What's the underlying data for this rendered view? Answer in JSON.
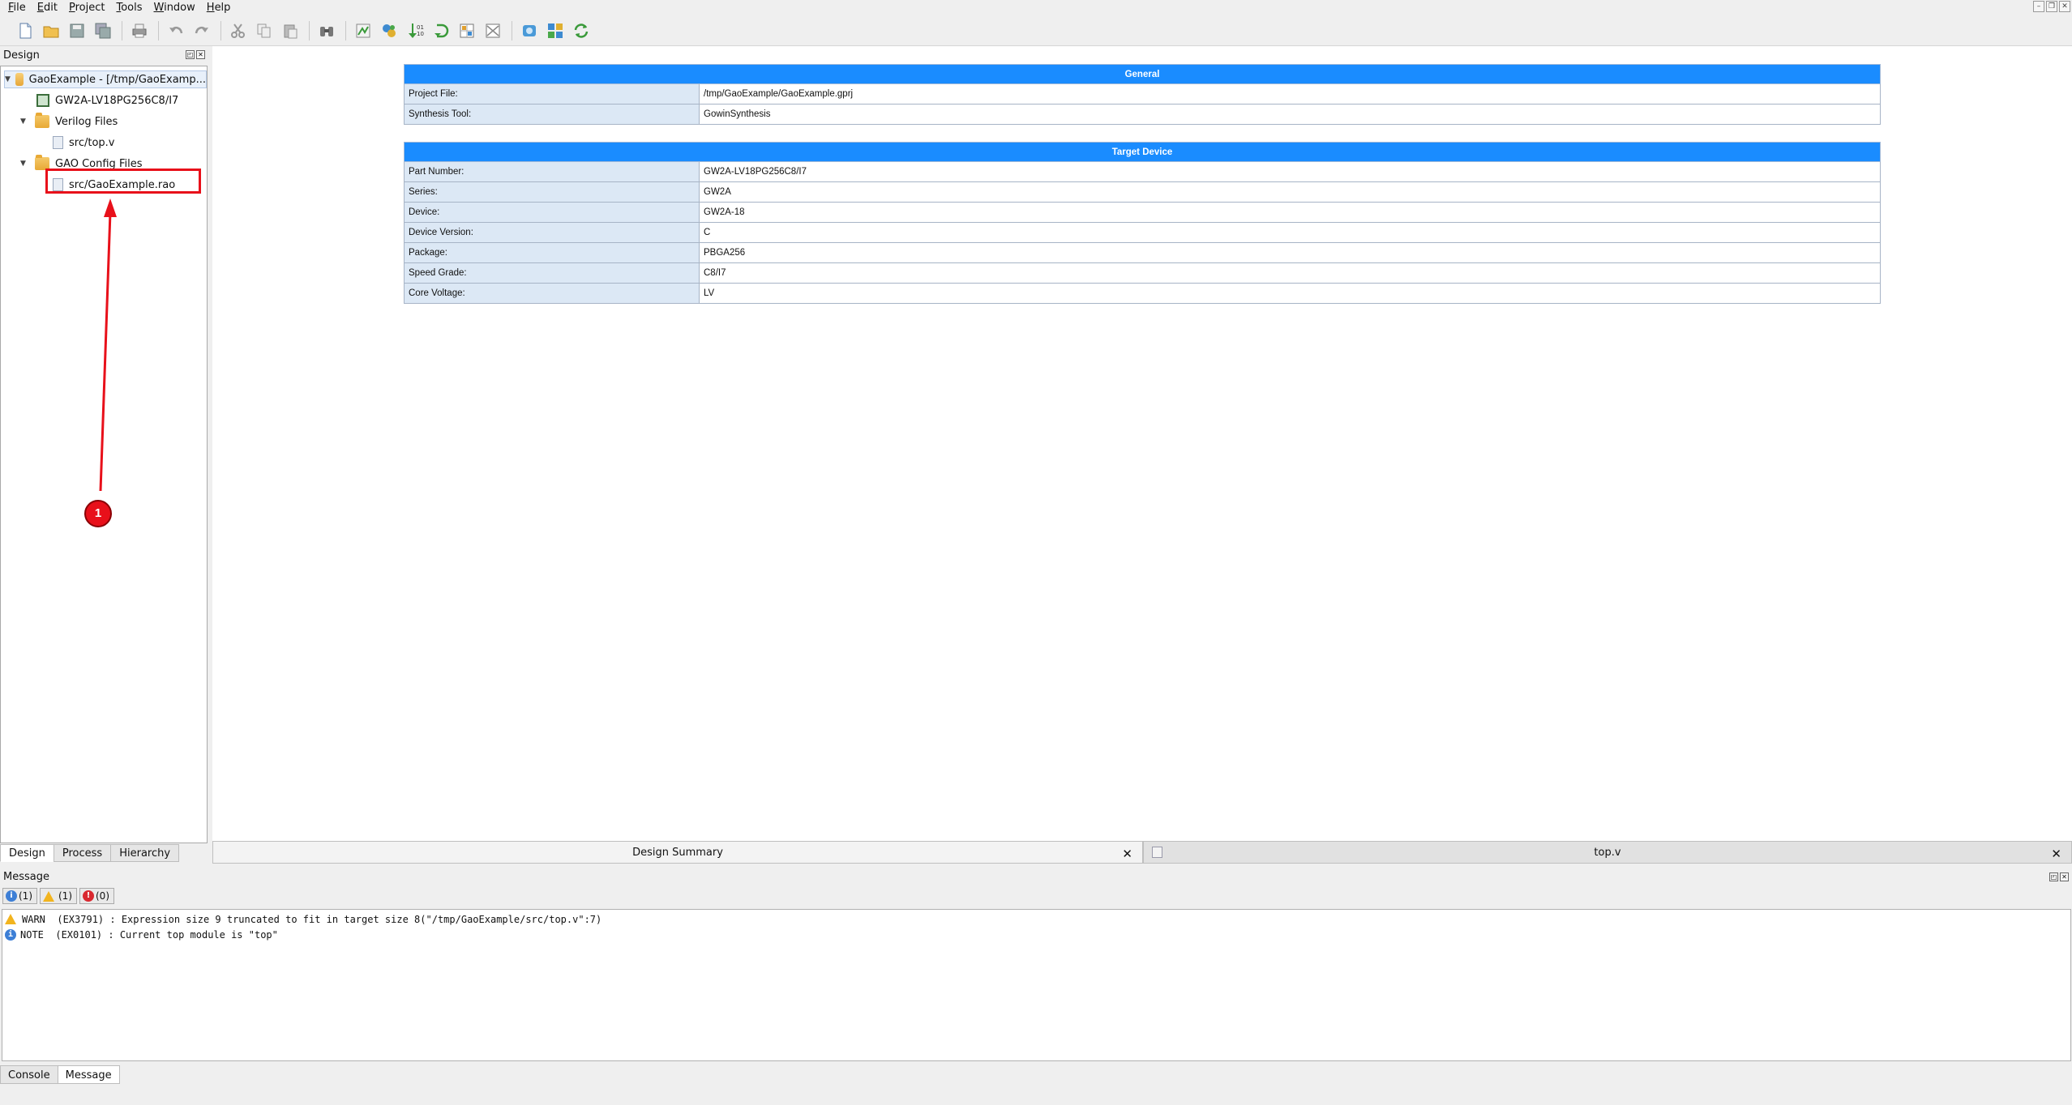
{
  "menu": [
    "File",
    "Edit",
    "Project",
    "Tools",
    "Window",
    "Help"
  ],
  "toolbar_icons": [
    "new-file-icon",
    "open-folder-icon",
    "save-icon",
    "save-all-icon",
    "print-icon",
    "undo-icon",
    "redo-icon",
    "cut-icon",
    "copy-icon",
    "paste-icon",
    "find-icon",
    "run-synthesis-icon",
    "place-route-icon",
    "program-device-icon",
    "restart-icon",
    "floorplanner-icon",
    "timing-icon",
    "gao-icon",
    "ip-core-icon",
    "refresh-icon"
  ],
  "design_panel": {
    "title": "Design",
    "tree": [
      {
        "label": "GaoExample - [/tmp/GaoExamp...",
        "icon": "project-icon",
        "level": 0
      },
      {
        "label": "GW2A-LV18PG256C8/I7",
        "icon": "chip-icon",
        "level": 1
      },
      {
        "label": "Verilog Files",
        "icon": "folder-icon",
        "level": 1
      },
      {
        "label": "src/top.v",
        "icon": "file-icon",
        "level": 2
      },
      {
        "label": "GAO Config Files",
        "icon": "folder-icon",
        "level": 1
      },
      {
        "label": "src/GaoExample.rao",
        "icon": "file-icon",
        "level": 2
      }
    ],
    "tabs": [
      "Design",
      "Process",
      "Hierarchy"
    ]
  },
  "summary": {
    "general": {
      "header": "General",
      "rows": [
        {
          "key": "Project File:",
          "value": "/tmp/GaoExample/GaoExample.gprj"
        },
        {
          "key": "Synthesis Tool:",
          "value": "GowinSynthesis"
        }
      ]
    },
    "target_device": {
      "header": "Target Device",
      "rows": [
        {
          "key": "Part Number:",
          "value": "GW2A-LV18PG256C8/I7"
        },
        {
          "key": "Series:",
          "value": "GW2A"
        },
        {
          "key": "Device:",
          "value": "GW2A-18"
        },
        {
          "key": "Device Version:",
          "value": "C"
        },
        {
          "key": "Package:",
          "value": "PBGA256"
        },
        {
          "key": "Speed Grade:",
          "value": "C8/I7"
        },
        {
          "key": "Core Voltage:",
          "value": "LV"
        }
      ]
    }
  },
  "doc_tabs": [
    {
      "label": "Design Summary",
      "close": "✕"
    },
    {
      "label": "top.v",
      "close": "✕"
    }
  ],
  "message_panel": {
    "title": "Message",
    "filters": [
      {
        "icon": "info-icon",
        "count": "(1)"
      },
      {
        "icon": "warning-icon",
        "count": "(1)"
      },
      {
        "icon": "error-icon",
        "count": "(0)"
      }
    ],
    "messages": [
      {
        "icon": "warning-icon",
        "text": "WARN  (EX3791) : Expression size 9 truncated to fit in target size 8(\"/tmp/GaoExample/src/top.v\":7)"
      },
      {
        "icon": "info-icon",
        "text": "NOTE  (EX0101) : Current top module is \"top\""
      }
    ],
    "tabs": [
      "Console",
      "Message"
    ]
  },
  "annotation": {
    "badge": "1",
    "color": "#e8101a"
  }
}
